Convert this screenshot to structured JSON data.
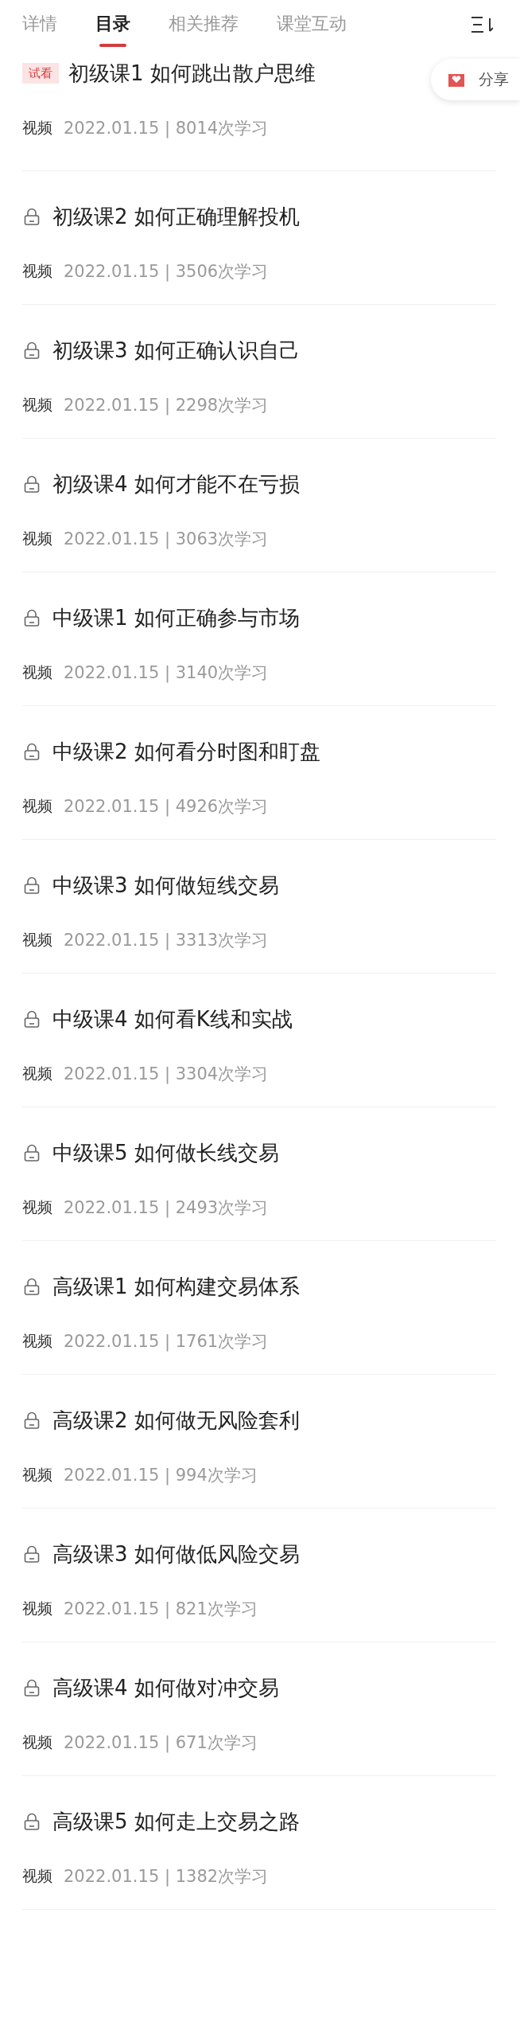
{
  "tabs": [
    {
      "label": "详情",
      "selected": false
    },
    {
      "label": "目录",
      "selected": true
    },
    {
      "label": "相关推荐",
      "selected": false
    },
    {
      "label": "课堂互动",
      "selected": false
    }
  ],
  "share_button": {
    "label": "分享"
  },
  "lessons": [
    {
      "kind": "trial",
      "badge": "试看",
      "title": "初级课1 如何跳出散户思维",
      "type": "视频",
      "meta": "2022.01.15 | 8014次学习"
    },
    {
      "kind": "locked",
      "title": "初级课2 如何正确理解投机",
      "type": "视频",
      "meta": "2022.01.15 | 3506次学习"
    },
    {
      "kind": "locked",
      "title": "初级课3 如何正确认识自己",
      "type": "视频",
      "meta": "2022.01.15 | 2298次学习"
    },
    {
      "kind": "locked",
      "title": "初级课4 如何才能不在亏损",
      "type": "视频",
      "meta": "2022.01.15 | 3063次学习"
    },
    {
      "kind": "locked",
      "title": "中级课1 如何正确参与市场",
      "type": "视频",
      "meta": "2022.01.15 | 3140次学习"
    },
    {
      "kind": "locked",
      "title": "中级课2 如何看分时图和盯盘",
      "type": "视频",
      "meta": "2022.01.15 | 4926次学习"
    },
    {
      "kind": "locked",
      "title": "中级课3 如何做短线交易",
      "type": "视频",
      "meta": "2022.01.15 | 3313次学习"
    },
    {
      "kind": "locked",
      "title": "中级课4 如何看K线和实战",
      "type": "视频",
      "meta": "2022.01.15 | 3304次学习"
    },
    {
      "kind": "locked",
      "title": "中级课5 如何做长线交易",
      "type": "视频",
      "meta": "2022.01.15 | 2493次学习"
    },
    {
      "kind": "locked",
      "title": "高级课1 如何构建交易体系",
      "type": "视频",
      "meta": "2022.01.15 | 1761次学习"
    },
    {
      "kind": "locked",
      "title": "高级课2 如何做无风险套利",
      "type": "视频",
      "meta": "2022.01.15 | 994次学习"
    },
    {
      "kind": "locked",
      "title": "高级课3 如何做低风险交易",
      "type": "视频",
      "meta": "2022.01.15 | 821次学习"
    },
    {
      "kind": "locked",
      "title": "高级课4 如何做对冲交易",
      "type": "视频",
      "meta": "2022.01.15 | 671次学习"
    },
    {
      "kind": "locked",
      "title": "高级课5 如何走上交易之路",
      "type": "视频",
      "meta": "2022.01.15 | 1382次学习"
    }
  ]
}
